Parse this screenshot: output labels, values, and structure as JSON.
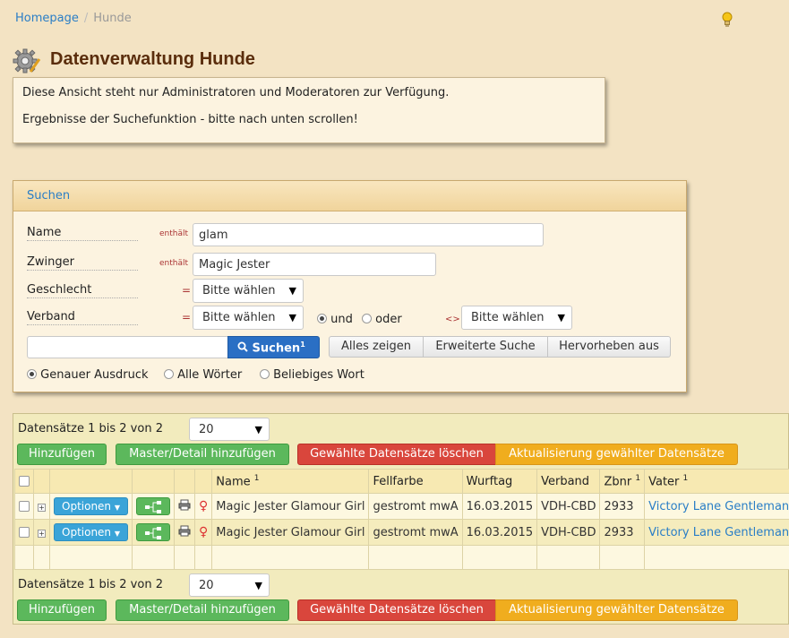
{
  "breadcrumb": {
    "home": "Homepage",
    "current": "Hunde"
  },
  "page_title": "Datenverwaltung Hunde",
  "info": {
    "line1": "Diese Ansicht steht nur Administratoren und Moderatoren zur Verfügung.",
    "line2": "Ergebnisse der Suchefunktion - bitte nach unten scrollen!"
  },
  "search": {
    "header": "Suchen",
    "name_label": "Name",
    "name_op": "enthält",
    "name_value": "glam",
    "zwinger_label": "Zwinger",
    "zwinger_op": "enthält",
    "zwinger_value": "Magic Jester",
    "geschlecht_label": "Geschlecht",
    "geschlecht_op": "=",
    "geschlecht_value": "Bitte wählen",
    "verband_label": "Verband",
    "verband_op": "=",
    "verband_value": "Bitte wählen",
    "und_label": "und",
    "oder_label": "oder",
    "ne_op": "<>",
    "verband2_value": "Bitte wählen",
    "quick_value": "",
    "search_button": "Suchen",
    "search_sup": "1",
    "show_all": "Alles zeigen",
    "advanced": "Erweiterte Suche",
    "highlight_off": "Hervorheben aus",
    "mode_exact": "Genauer Ausdruck",
    "mode_all": "Alle Wörter",
    "mode_any": "Beliebiges Wort"
  },
  "grid": {
    "records_text": "Datensätze 1 bis 2 von 2",
    "page_size": "20",
    "add": "Hinzufügen",
    "add_master_detail": "Master/Detail hinzufügen",
    "delete_selected": "Gewählte Datensätze löschen",
    "update_selected": "Aktualisierung gewählter Datensätze",
    "options_label": "Optionen",
    "columns": {
      "name": "Name",
      "name_sup": "1",
      "fellfarbe": "Fellfarbe",
      "wurftag": "Wurftag",
      "verband": "Verband",
      "zbnr": "Zbnr",
      "zbnr_sup": "1",
      "vater": "Vater",
      "vater_sup": "1"
    },
    "rows": [
      {
        "name": "Magic Jester Glamour Girl",
        "fellfarbe": "gestromt mwA",
        "wurftag": "16.03.2015",
        "verband": "VDH-CBD",
        "zbnr": "2933",
        "vater": "Victory Lane Gentleman",
        "sex": "♀"
      },
      {
        "name": "Magic Jester Glamour Girl",
        "fellfarbe": "gestromt mwA",
        "wurftag": "16.03.2015",
        "verband": "VDH-CBD",
        "zbnr": "2933",
        "vater": "Victory Lane Gentleman",
        "sex": "♀"
      }
    ]
  }
}
